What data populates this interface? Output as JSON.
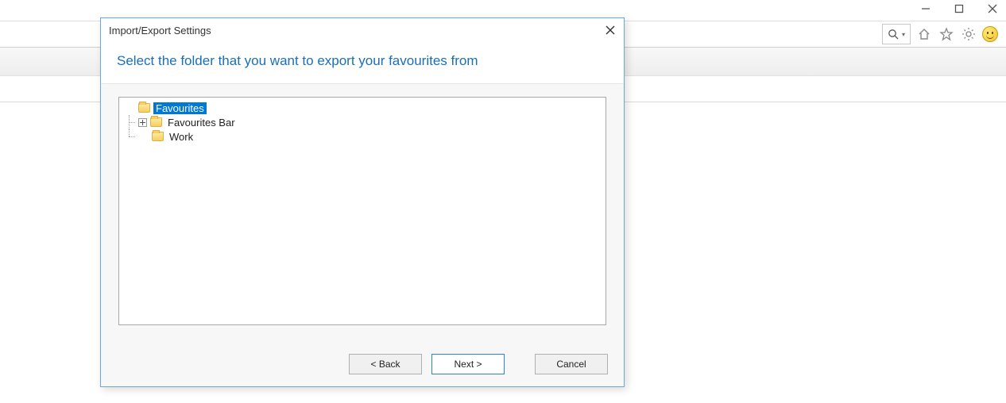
{
  "window_controls": {
    "minimize": "minimize-icon",
    "maximize": "maximize-icon",
    "close": "close-icon"
  },
  "toolbar": {
    "search": {
      "icon": "search-icon",
      "placeholder": ""
    },
    "home": "home-icon",
    "favorites": "star-icon",
    "settings": "gear-icon",
    "feedback": "smiley-icon"
  },
  "dialog": {
    "title": "Import/Export Settings",
    "heading": "Select the folder that you want to export your favourites from",
    "tree": {
      "root": {
        "label": "Favourites",
        "selected": true,
        "children": [
          {
            "label": "Favourites Bar",
            "expandable": true
          },
          {
            "label": "Work",
            "expandable": false
          }
        ]
      }
    },
    "buttons": {
      "back": "< Back",
      "next": "Next >",
      "cancel": "Cancel"
    }
  }
}
